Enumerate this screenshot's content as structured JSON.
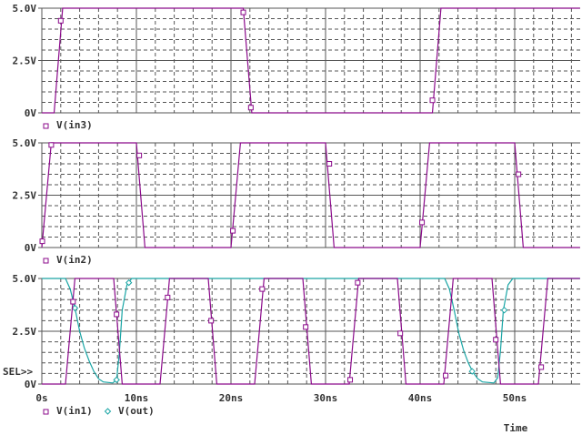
{
  "colors": {
    "grid": "#555555",
    "trace_purple": "#8b0a8b",
    "trace_cyan": "#1aa5a5",
    "text": "#333333"
  },
  "chart_data": [
    {
      "type": "line",
      "ylim": [
        0,
        5
      ],
      "xlim": [
        0,
        56.9
      ],
      "yticks": [
        "5.0V",
        "2.5V",
        "0V"
      ],
      "ytick_values": [
        5,
        2.5,
        0
      ],
      "legend": [
        {
          "name": "V(in3)",
          "marker": "square",
          "color": "trace_purple"
        }
      ],
      "series": [
        {
          "name": "V(in3)",
          "color": "trace_purple",
          "marker": "square",
          "points": [
            [
              0,
              0
            ],
            [
              1.3,
              0
            ],
            [
              2.2,
              5
            ],
            [
              21.3,
              5
            ],
            [
              22.2,
              0
            ],
            [
              41.3,
              0
            ],
            [
              42.2,
              5
            ],
            [
              56.9,
              5
            ]
          ],
          "markers": [
            [
              2.0,
              4.4
            ],
            [
              21.3,
              4.8
            ],
            [
              22.1,
              0.25
            ],
            [
              41.3,
              0.6
            ]
          ]
        }
      ]
    },
    {
      "type": "line",
      "ylim": [
        0,
        5
      ],
      "xlim": [
        0,
        56.9
      ],
      "yticks": [
        "5.0V",
        "2.5V",
        "0V"
      ],
      "ytick_values": [
        5,
        2.5,
        0
      ],
      "legend": [
        {
          "name": "V(in2)",
          "marker": "square",
          "color": "trace_purple"
        }
      ],
      "series": [
        {
          "name": "V(in2)",
          "color": "trace_purple",
          "marker": "square",
          "points": [
            [
              0,
              0
            ],
            [
              1.0,
              5
            ],
            [
              10.0,
              5
            ],
            [
              10.9,
              0
            ],
            [
              20.0,
              0
            ],
            [
              21.0,
              5
            ],
            [
              30.0,
              5
            ],
            [
              30.9,
              0
            ],
            [
              40.0,
              0
            ],
            [
              41.0,
              5
            ],
            [
              50.0,
              5
            ],
            [
              50.9,
              0
            ],
            [
              56.9,
              0
            ]
          ],
          "markers": [
            [
              0.05,
              0.3
            ],
            [
              1.0,
              4.9
            ],
            [
              10.3,
              4.4
            ],
            [
              20.2,
              0.8
            ],
            [
              30.4,
              4.0
            ],
            [
              40.2,
              1.2
            ],
            [
              50.4,
              3.5
            ]
          ]
        }
      ]
    },
    {
      "type": "line",
      "ylim": [
        0,
        5
      ],
      "xlim": [
        0,
        56.9
      ],
      "yticks": [
        "5.0V",
        "2.5V",
        "0V"
      ],
      "ytick_values": [
        5,
        2.5,
        0
      ],
      "xticks": [
        "0s",
        "10ns",
        "20ns",
        "30ns",
        "40ns",
        "50ns"
      ],
      "xtick_values": [
        0,
        10,
        20,
        30,
        40,
        50
      ],
      "xlabel": "Time",
      "selector": "SEL>>",
      "legend": [
        {
          "name": "V(in1)",
          "marker": "square",
          "color": "trace_purple"
        },
        {
          "name": "V(out)",
          "marker": "diamond",
          "color": "trace_cyan"
        }
      ],
      "series": [
        {
          "name": "V(out)",
          "color": "trace_cyan",
          "marker": "diamond",
          "points": [
            [
              0,
              5
            ],
            [
              2.5,
              5
            ],
            [
              3.0,
              4.5
            ],
            [
              3.5,
              3.6
            ],
            [
              4.0,
              2.5
            ],
            [
              4.5,
              1.7
            ],
            [
              5.0,
              1.1
            ],
            [
              5.5,
              0.6
            ],
            [
              6.0,
              0.25
            ],
            [
              6.5,
              0.1
            ],
            [
              7.5,
              0.05
            ],
            [
              7.9,
              0.2
            ],
            [
              8.2,
              1.5
            ],
            [
              8.5,
              3.5
            ],
            [
              9.0,
              4.7
            ],
            [
              9.5,
              5
            ],
            [
              42.6,
              5
            ],
            [
              43.1,
              4.5
            ],
            [
              43.6,
              3.5
            ],
            [
              44.1,
              2.4
            ],
            [
              44.6,
              1.6
            ],
            [
              45.1,
              1.0
            ],
            [
              45.6,
              0.55
            ],
            [
              46.1,
              0.25
            ],
            [
              46.6,
              0.1
            ],
            [
              47.8,
              0.05
            ],
            [
              48.2,
              0.3
            ],
            [
              48.5,
              1.6
            ],
            [
              48.8,
              3.5
            ],
            [
              49.3,
              4.7
            ],
            [
              49.8,
              5
            ],
            [
              56.9,
              5
            ]
          ],
          "markers": [
            [
              3.5,
              3.6
            ],
            [
              7.9,
              0.2
            ],
            [
              9.2,
              4.8
            ],
            [
              45.5,
              0.6
            ],
            [
              48.9,
              3.5
            ]
          ]
        },
        {
          "name": "V(in1)",
          "color": "trace_purple",
          "marker": "square",
          "points": [
            [
              0,
              0
            ],
            [
              2.5,
              0
            ],
            [
              3.5,
              5
            ],
            [
              7.6,
              5
            ],
            [
              8.5,
              0
            ],
            [
              12.5,
              0
            ],
            [
              13.5,
              5
            ],
            [
              17.6,
              5
            ],
            [
              18.5,
              0
            ],
            [
              22.5,
              0
            ],
            [
              23.5,
              5
            ],
            [
              27.6,
              5
            ],
            [
              28.5,
              0
            ],
            [
              32.5,
              0
            ],
            [
              33.5,
              5
            ],
            [
              37.6,
              5
            ],
            [
              38.5,
              0
            ],
            [
              42.5,
              0
            ],
            [
              43.5,
              5
            ],
            [
              47.6,
              5
            ],
            [
              48.5,
              0
            ],
            [
              52.5,
              0
            ],
            [
              53.5,
              5
            ],
            [
              56.9,
              5
            ]
          ],
          "markers": [
            [
              3.3,
              3.9
            ],
            [
              7.9,
              3.3
            ],
            [
              13.3,
              4.1
            ],
            [
              17.9,
              3.0
            ],
            [
              23.3,
              4.5
            ],
            [
              27.9,
              2.7
            ],
            [
              32.6,
              0.2
            ],
            [
              33.4,
              4.8
            ],
            [
              37.9,
              2.4
            ],
            [
              42.7,
              0.4
            ],
            [
              48.0,
              2.1
            ],
            [
              52.8,
              0.8
            ]
          ]
        }
      ]
    }
  ]
}
